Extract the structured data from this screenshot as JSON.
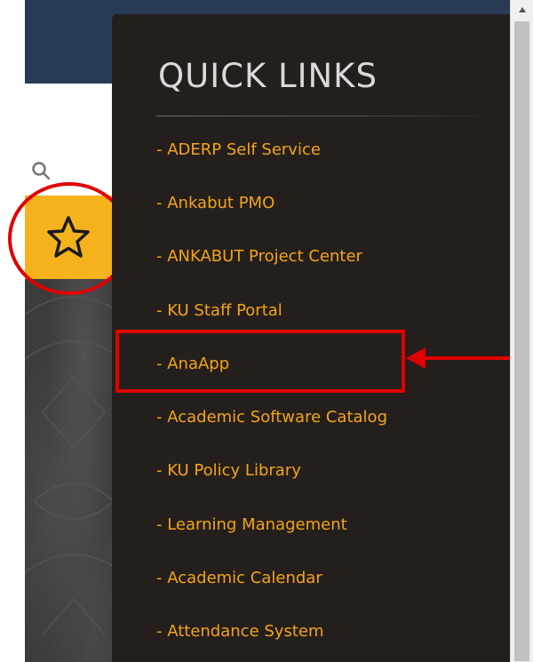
{
  "quick_links": {
    "title": "QUICK LINKS",
    "items": [
      {
        "label": "- ADERP Self Service"
      },
      {
        "label": "- Ankabut PMO"
      },
      {
        "label": "- ANKABUT Project Center"
      },
      {
        "label": "- KU Staff Portal"
      },
      {
        "label": "- AnaApp"
      },
      {
        "label": "- Academic Software Catalog"
      },
      {
        "label": "- KU Policy Library"
      },
      {
        "label": "- Learning Management"
      },
      {
        "label": "- Academic Calendar"
      },
      {
        "label": "- Attendance System"
      }
    ],
    "highlighted_item": "- AnaApp"
  },
  "toolbar": {
    "search_icon": "search-icon",
    "star_icon": "star-icon",
    "star_button_color": "#f5b21c"
  },
  "colors": {
    "banner": "#283a55",
    "panel_bg": "#241f1d",
    "link": "#f2a517",
    "title": "#d9d9d9",
    "annotation": "#e00000"
  }
}
